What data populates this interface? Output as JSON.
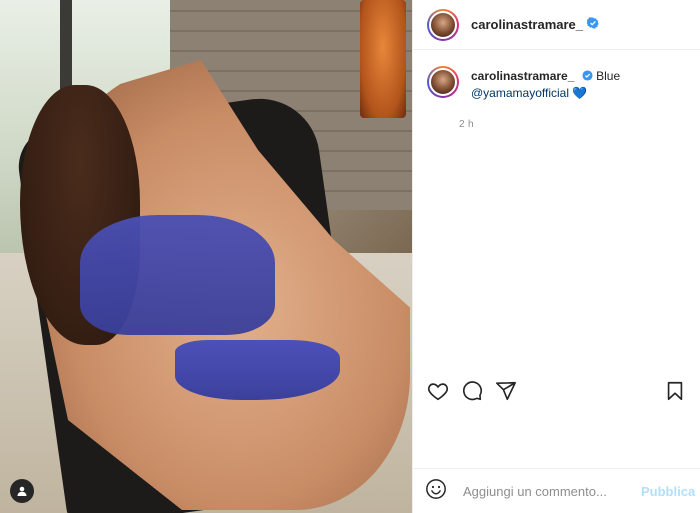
{
  "post": {
    "username": "carolinastramare_",
    "caption_word": "Blue",
    "mention": "@yamamayofficial",
    "heart_emoji": "💙",
    "timestamp": "2 h"
  },
  "composer": {
    "placeholder": "Aggiungi un commento...",
    "publish_label": "Pubblica"
  },
  "colors": {
    "verified": "#3897f0",
    "publish_disabled": "#b2dffc",
    "mention": "#00376b"
  },
  "icons": {
    "like": "heart-icon",
    "comment": "comment-icon",
    "share": "paper-plane-icon",
    "save": "bookmark-icon",
    "emoji": "emoji-icon",
    "tag": "user-tag-icon"
  }
}
